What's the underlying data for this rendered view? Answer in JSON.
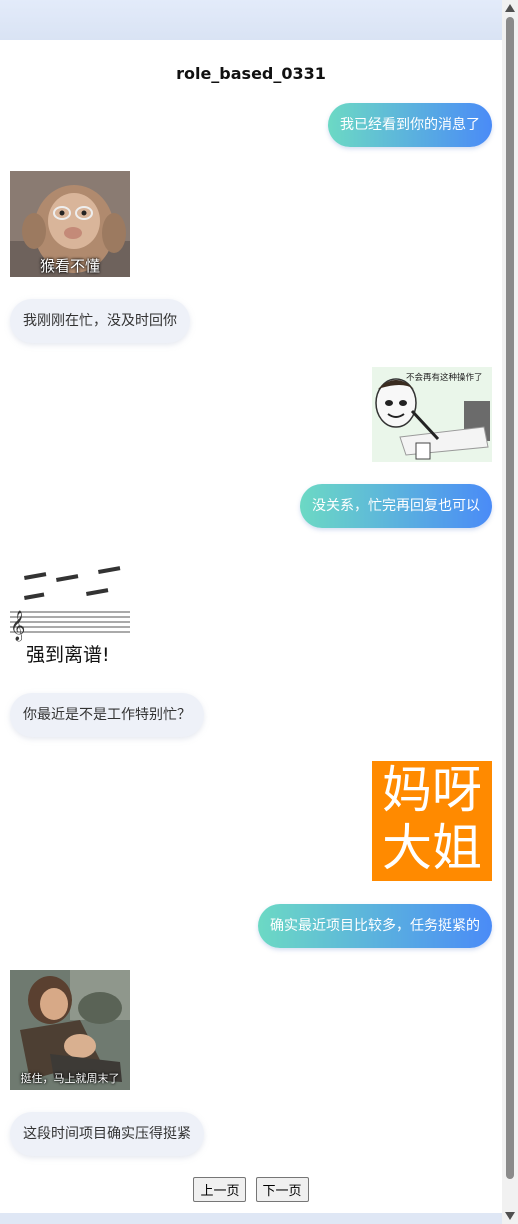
{
  "title": "role_based_0331",
  "messages": [
    {
      "side": "right",
      "type": "text",
      "text": "我已经看到你的消息了"
    },
    {
      "side": "left",
      "type": "sticker",
      "caption": "猴看不懂",
      "icon": "monkey-with-glasses-sticker"
    },
    {
      "side": "left",
      "type": "text",
      "text": "我刚刚在忙，没及时回你"
    },
    {
      "side": "right",
      "type": "sticker",
      "caption": "不会再有这种操作了",
      "icon": "panda-man-meme-sticker"
    },
    {
      "side": "right",
      "type": "text",
      "text": "没关系，忙完再回复也可以"
    },
    {
      "side": "left",
      "type": "sticker",
      "caption": "强到离谱!",
      "icon": "music-staff-sticker"
    },
    {
      "side": "left",
      "type": "text",
      "text": "你最近是不是工作特别忙？"
    },
    {
      "side": "right",
      "type": "sticker",
      "caption_line1": "妈呀",
      "caption_line2": "大姐",
      "icon": "orange-text-sticker"
    },
    {
      "side": "right",
      "type": "text",
      "text": "确实最近项目比较多，任务挺紧的"
    },
    {
      "side": "left",
      "type": "sticker",
      "caption": "挺住，马上就周末了",
      "icon": "tv-drama-screenshot-sticker"
    },
    {
      "side": "left",
      "type": "text",
      "text": "这段时间项目确实压得挺紧"
    }
  ],
  "pager": {
    "prev": "上一页",
    "next": "下一页"
  },
  "colors": {
    "outgoing_gradient_start": "#6cd9c4",
    "outgoing_gradient_end": "#4a8bf7",
    "incoming_bg": "#eef1f8",
    "sticker_orange": "#ff8a00"
  }
}
